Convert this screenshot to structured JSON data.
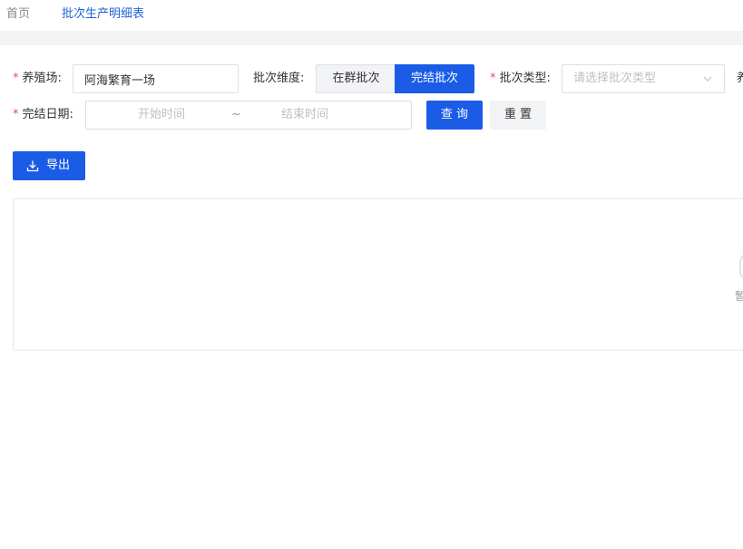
{
  "tabs": {
    "home": "首页",
    "active": "批次生产明细表"
  },
  "form": {
    "farm": {
      "label": "养殖场",
      "value": "阿海繁育一场"
    },
    "dimension": {
      "label": "批次维度",
      "options": [
        "在群批次",
        "完结批次"
      ],
      "selected": "完结批次"
    },
    "batch_type": {
      "label": "批次类型",
      "placeholder": "请选择批次类型"
    },
    "extra_label_partial": "养",
    "finish_date": {
      "label": "完结日期",
      "start_placeholder": "开始时间",
      "separator": "~",
      "end_placeholder": "结束时间"
    },
    "query_button": "查 询",
    "reset_button": "重 置",
    "colon": ":",
    "required_mark": "*"
  },
  "toolbar": {
    "export_button": "导出"
  },
  "table": {
    "empty_text_partial": "暂"
  },
  "colors": {
    "primary": "#1a5ce6",
    "active_tab": "#1f63d6",
    "required": "#e34d59"
  }
}
